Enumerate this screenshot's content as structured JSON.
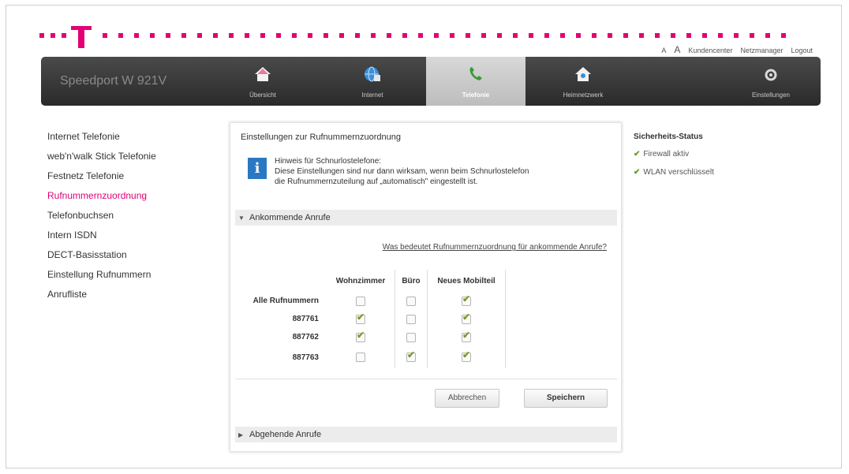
{
  "colors": {
    "brand": "#e20074",
    "nav_dark": "#2a2a2a",
    "ok": "#6a9a20"
  },
  "brand": {
    "logo_icon": "telekom-t-icon"
  },
  "util_links": {
    "font_small": "A",
    "font_large": "A",
    "kundencenter": "Kundencenter",
    "netzmanager": "Netzmanager",
    "logout": "Logout"
  },
  "header": {
    "product": "Speedport W 921V",
    "nav": [
      {
        "label": "Übersicht",
        "icon": "home-icon"
      },
      {
        "label": "Internet",
        "icon": "globe-icon"
      },
      {
        "label": "Telefonie",
        "icon": "phone-icon",
        "active": true
      },
      {
        "label": "Heimnetzwerk",
        "icon": "home-network-icon"
      },
      {
        "label": "Einstellungen",
        "icon": "gear-icon"
      }
    ]
  },
  "sidebar": {
    "items": [
      {
        "label": "Internet Telefonie"
      },
      {
        "label": "web'n'walk Stick Telefonie"
      },
      {
        "label": "Festnetz Telefonie"
      },
      {
        "label": "Rufnummernzuordnung",
        "active": true
      },
      {
        "label": "Telefonbuchsen"
      },
      {
        "label": "Intern ISDN"
      },
      {
        "label": "DECT-Basisstation"
      },
      {
        "label": "Einstellung Rufnummern"
      },
      {
        "label": "Anrufliste"
      }
    ]
  },
  "main": {
    "title": "Einstellungen zur Rufnummernzuordnung",
    "hint": {
      "line1": "Hinweis für Schnurlostelefone:",
      "line2": "Diese Einstellungen sind nur dann wirksam, wenn beim Schnurlostelefon",
      "line3": "die Rufnummernzuteilung auf „automatisch\" eingestellt ist."
    },
    "incoming_section": "Ankommende Anrufe",
    "help_link": "Was bedeutet Rufnummernzuordnung für ankommende Anrufe?",
    "columns": [
      "Wohnzimmer",
      "Büro",
      "Neues Mobilteil"
    ],
    "rows": [
      {
        "label": "Alle Rufnummern",
        "checked": [
          false,
          false,
          true
        ]
      },
      {
        "label": "887761",
        "checked": [
          true,
          false,
          true
        ]
      },
      {
        "label": "887762",
        "checked": [
          true,
          false,
          true
        ]
      },
      {
        "label": "887763",
        "checked": [
          false,
          true,
          true
        ]
      }
    ],
    "cancel": "Abbrechen",
    "save": "Speichern",
    "outgoing_section": "Abgehende Anrufe"
  },
  "status": {
    "title": "Sicherheits-Status",
    "items": [
      "Firewall aktiv",
      "WLAN verschlüsselt"
    ]
  }
}
